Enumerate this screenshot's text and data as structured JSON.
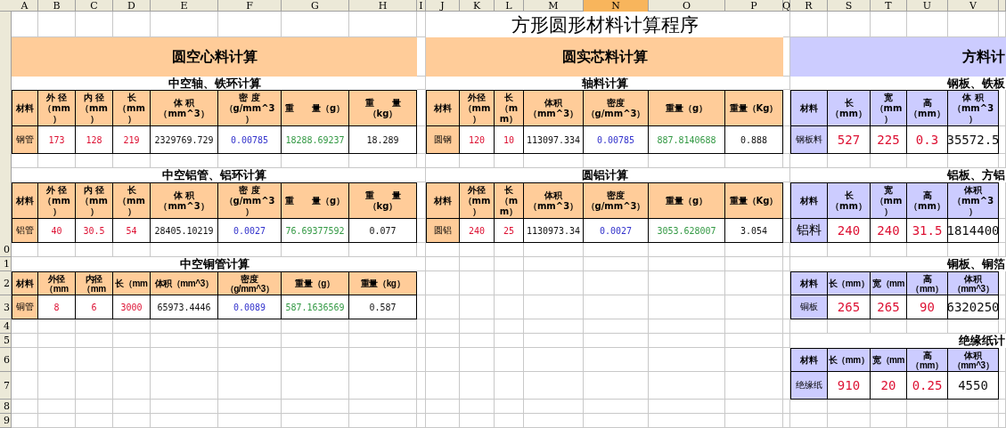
{
  "column_headers": [
    {
      "label": "A",
      "selected": false
    },
    {
      "label": "B",
      "selected": false
    },
    {
      "label": "C",
      "selected": false
    },
    {
      "label": "D",
      "selected": false
    },
    {
      "label": "E",
      "selected": false
    },
    {
      "label": "F",
      "selected": false
    },
    {
      "label": "G",
      "selected": false
    },
    {
      "label": "H",
      "selected": false
    },
    {
      "label": "I",
      "selected": false
    },
    {
      "label": "J",
      "selected": false
    },
    {
      "label": "K",
      "selected": false
    },
    {
      "label": "L",
      "selected": false
    },
    {
      "label": "M",
      "selected": false
    },
    {
      "label": "N",
      "selected": true
    },
    {
      "label": "O",
      "selected": false
    },
    {
      "label": "P",
      "selected": false
    },
    {
      "label": "Q",
      "selected": false
    },
    {
      "label": "R",
      "selected": false
    },
    {
      "label": "S",
      "selected": false
    },
    {
      "label": "T",
      "selected": false
    },
    {
      "label": "U",
      "selected": false
    },
    {
      "label": "V",
      "selected": false
    }
  ],
  "row_headers": [
    "0",
    "1",
    "2",
    "3",
    "4",
    "5",
    "6",
    "7",
    "8",
    "9"
  ],
  "title": "方形圆形材料计算程序",
  "panels": [
    {
      "title": "圆空心料计算",
      "color": "#ffcc99",
      "tables": [
        {
          "title": "中空轴、铁环计算",
          "columns": [
            "材料",
            "外 径（mm）",
            "内 径（mm）",
            "长（mm）",
            "体 积（mm^3）",
            "密 度（g/mm^3）",
            "重　　量（g）",
            "重　　量（kg）"
          ],
          "row": [
            {
              "text": "钢管",
              "kind": "label"
            },
            {
              "text": "173",
              "kind": "input"
            },
            {
              "text": "128",
              "kind": "input"
            },
            {
              "text": "219",
              "kind": "input"
            },
            {
              "text": "2329769.729",
              "kind": "plain"
            },
            {
              "text": "0.00785",
              "kind": "density"
            },
            {
              "text": "18288.69237",
              "kind": "weight"
            },
            {
              "text": "18.289",
              "kind": "plain"
            }
          ]
        },
        {
          "title": "中空铝管、铝环计算",
          "columns": [
            "材料",
            "外 径（mm）",
            "内 径（mm）",
            "长（mm）",
            "体 积（mm^3）",
            "密 度（g/mm^3）",
            "重　　量（g）",
            "重　　量（kg）"
          ],
          "row": [
            {
              "text": "铝管",
              "kind": "label"
            },
            {
              "text": "40",
              "kind": "input"
            },
            {
              "text": "30.5",
              "kind": "input"
            },
            {
              "text": "54",
              "kind": "input"
            },
            {
              "text": "28405.10219",
              "kind": "plain"
            },
            {
              "text": "0.0027",
              "kind": "density"
            },
            {
              "text": "76.69377592",
              "kind": "weight"
            },
            {
              "text": "0.077",
              "kind": "plain"
            }
          ]
        },
        {
          "title": "中空铜管计算",
          "columns": [
            "材料",
            "外径（mm",
            "内径（mm",
            "长（mm",
            "体积（mm^3）",
            "密度（g/mm^3）",
            "重量（g）",
            "重量（kg）"
          ],
          "row": [
            {
              "text": "铜管",
              "kind": "label"
            },
            {
              "text": "8",
              "kind": "input"
            },
            {
              "text": "6",
              "kind": "input"
            },
            {
              "text": "3000",
              "kind": "input"
            },
            {
              "text": "65973.4446",
              "kind": "plain"
            },
            {
              "text": "0.0089",
              "kind": "density"
            },
            {
              "text": "587.1636569",
              "kind": "weight"
            },
            {
              "text": "0.587",
              "kind": "plain"
            }
          ]
        }
      ]
    },
    {
      "title": "圆实芯料计算",
      "color": "#ffcc99",
      "tables": [
        {
          "title": "轴料计算",
          "columns": [
            "材料",
            "外径（mm）",
            "长（mm）",
            "体积（mm^3）",
            "密度（g/mm^3）",
            "重量（g）",
            "重量（Kg）"
          ],
          "row": [
            {
              "text": "圆钢",
              "kind": "label"
            },
            {
              "text": "120",
              "kind": "input"
            },
            {
              "text": "10",
              "kind": "input"
            },
            {
              "text": "113097.334",
              "kind": "plain"
            },
            {
              "text": "0.00785",
              "kind": "density"
            },
            {
              "text": "887.8140688",
              "kind": "weight"
            },
            {
              "text": "0.888",
              "kind": "plain"
            }
          ]
        },
        {
          "title": "圆铝计算",
          "columns": [
            "材料",
            "外径（mm）",
            "长（mm）",
            "体积（mm^3）",
            "密度（g/mm^3）",
            "重量（g）",
            "重量（Kg）"
          ],
          "row": [
            {
              "text": "圆铝",
              "kind": "label"
            },
            {
              "text": "240",
              "kind": "input"
            },
            {
              "text": "25",
              "kind": "input"
            },
            {
              "text": "1130973.34",
              "kind": "plain"
            },
            {
              "text": "0.0027",
              "kind": "density"
            },
            {
              "text": "3053.628007",
              "kind": "weight"
            },
            {
              "text": "3.054",
              "kind": "plain"
            }
          ]
        }
      ]
    },
    {
      "title": "方料计",
      "color": "#ccccff",
      "tables": [
        {
          "title": "钢板、铁板",
          "columns": [
            "材料",
            "长（mm）",
            "宽（mm）",
            "高（mm）",
            "体 积（mm^3）"
          ],
          "row": [
            {
              "text": "钢板料",
              "kind": "label"
            },
            {
              "text": "527",
              "kind": "input"
            },
            {
              "text": "225",
              "kind": "input"
            },
            {
              "text": "0.3",
              "kind": "input"
            },
            {
              "text": "35572.5",
              "kind": "plain"
            }
          ]
        },
        {
          "title": "铝板、方铝",
          "columns": [
            "材料",
            "长（mm）",
            "宽（mm）",
            "高（mm）",
            "体积（mm^3）"
          ],
          "row": [
            {
              "text": "铝料",
              "kind": "label"
            },
            {
              "text": "240",
              "kind": "input"
            },
            {
              "text": "240",
              "kind": "input"
            },
            {
              "text": "31.5",
              "kind": "input"
            },
            {
              "text": "1814400",
              "kind": "plain"
            }
          ]
        },
        {
          "title": "铜板、铜箔",
          "columns": [
            "材料",
            "长（mm）",
            "宽（mm",
            "高（mm）",
            "体积（mm^3）"
          ],
          "row": [
            {
              "text": "铜板",
              "kind": "label"
            },
            {
              "text": "265",
              "kind": "input"
            },
            {
              "text": "265",
              "kind": "input"
            },
            {
              "text": "90",
              "kind": "input"
            },
            {
              "text": "6320250",
              "kind": "plain"
            }
          ]
        },
        {
          "title": "绝缘纸计",
          "columns": [
            "材料",
            "长（mm）",
            "宽（mm",
            "高（mm）",
            "体积（mm^3）"
          ],
          "row": [
            {
              "text": "绝缘纸",
              "kind": "label"
            },
            {
              "text": "910",
              "kind": "input"
            },
            {
              "text": "20",
              "kind": "input"
            },
            {
              "text": "0.25",
              "kind": "input"
            },
            {
              "text": "4550",
              "kind": "plain"
            }
          ]
        }
      ]
    }
  ]
}
